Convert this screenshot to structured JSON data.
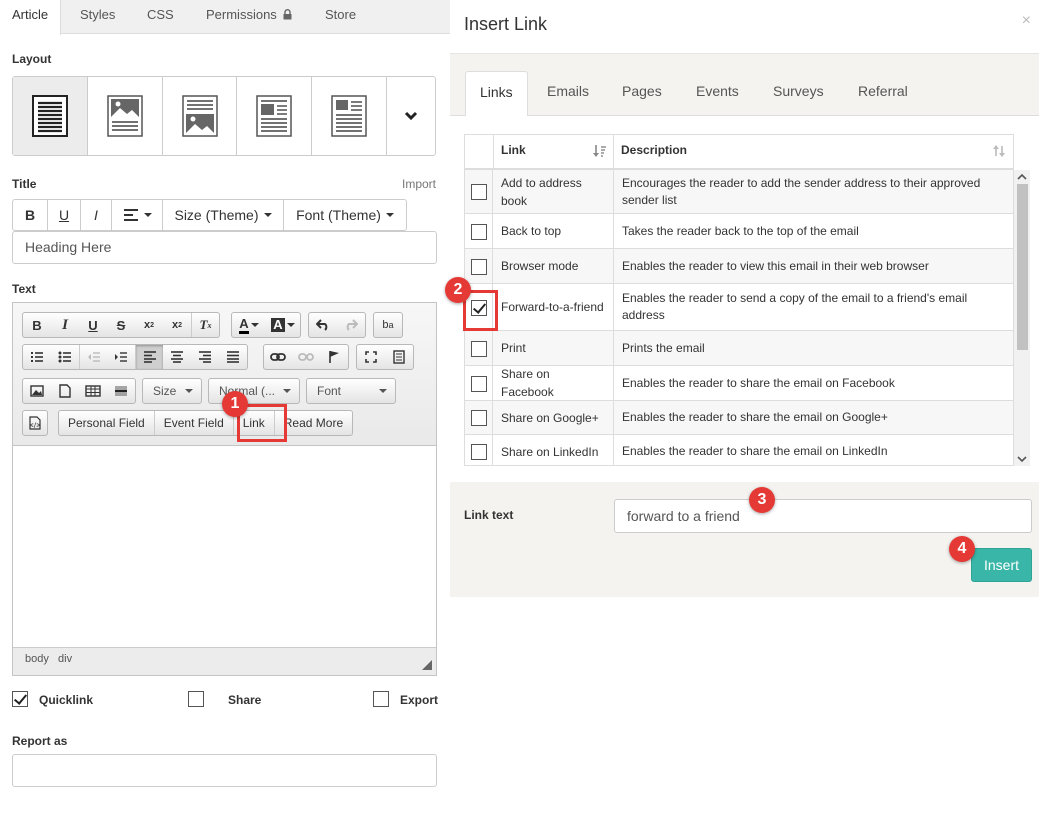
{
  "left": {
    "tabs": [
      {
        "label": "Article"
      },
      {
        "label": "Styles"
      },
      {
        "label": "CSS"
      },
      {
        "label": "Permissions"
      },
      {
        "label": "Store"
      }
    ],
    "layout_label": "Layout",
    "title_label": "Title",
    "import_label": "Import",
    "title_toolbar": {
      "bold": "B",
      "underline": "U",
      "italic": "I",
      "size": "Size (Theme)",
      "font": "Font (Theme)"
    },
    "title_value": "Heading Here",
    "text_label": "Text",
    "editor": {
      "size_combo": "Size",
      "format_combo": "Normal (...",
      "font_combo": "Font",
      "personal_field": "Personal Field",
      "event_field": "Event Field",
      "link": "Link",
      "read_more": "Read More",
      "status_path": [
        "body",
        "div"
      ]
    },
    "options": [
      {
        "label": "Quicklink",
        "checked": true
      },
      {
        "label": "Share",
        "checked": false
      },
      {
        "label": "Export",
        "checked": false
      }
    ],
    "report_as_label": "Report as",
    "report_as_value": ""
  },
  "modal": {
    "title": "Insert Link",
    "close": "×",
    "tabs": [
      {
        "label": "Links",
        "active": true
      },
      {
        "label": "Emails",
        "active": false
      },
      {
        "label": "Pages",
        "active": false
      },
      {
        "label": "Events",
        "active": false
      },
      {
        "label": "Surveys",
        "active": false
      },
      {
        "label": "Referral",
        "active": false
      }
    ],
    "columns": {
      "link": "Link",
      "description": "Description"
    },
    "rows": [
      {
        "link": "Add to address book",
        "description": "Encourages the reader to add the sender address to their approved sender list",
        "checked": false
      },
      {
        "link": "Back to top",
        "description": "Takes the reader back to the top of the email",
        "checked": false
      },
      {
        "link": "Browser mode",
        "description": "Enables the reader to view this email in their web browser",
        "checked": false
      },
      {
        "link": "Forward-to-a-friend",
        "description": "Enables the reader to send a copy of the email to a friend's email address",
        "checked": true
      },
      {
        "link": "Print",
        "description": "Prints the email",
        "checked": false
      },
      {
        "link": "Share on Facebook",
        "description": "Enables the reader to share the email on Facebook",
        "checked": false
      },
      {
        "link": "Share on Google+",
        "description": "Enables the reader to share the email on Google+",
        "checked": false
      },
      {
        "link": "Share on LinkedIn",
        "description": "Enables the reader to share the email on LinkedIn",
        "checked": false
      }
    ],
    "link_text_label": "Link text",
    "link_text_value": "forward to a friend",
    "insert_label": "Insert"
  },
  "markers": [
    "1",
    "2",
    "3",
    "4"
  ],
  "colors": {
    "accent": "#3ab6a8",
    "marker": "#e53935"
  }
}
